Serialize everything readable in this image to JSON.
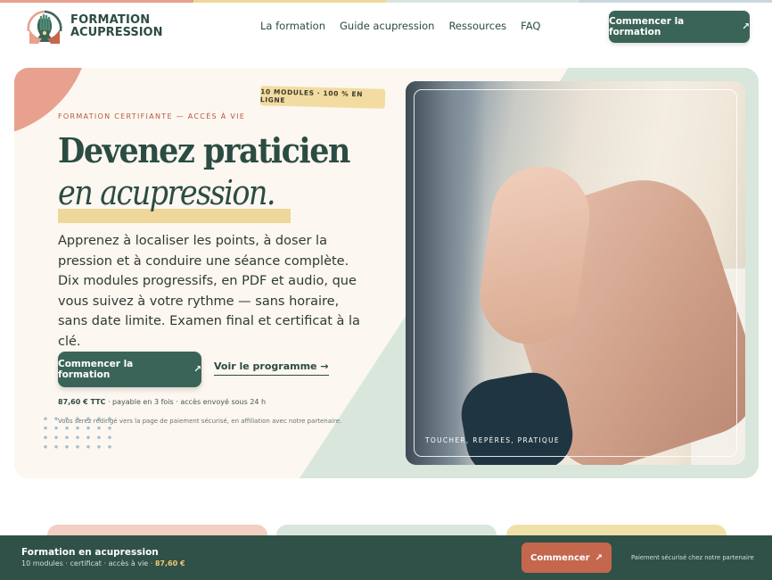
{
  "colors": {
    "strip": [
      "#e8a18e",
      "#efd79b",
      "#d8e6dc",
      "#c9d7df"
    ],
    "primary": "#3b6458",
    "coral": "#c4674d",
    "cards": [
      "#f1cfc2",
      "#d8e6dc",
      "#efe0a8"
    ]
  },
  "brand": {
    "line1": "FORMATION",
    "line2": "ACUPRESSION",
    "logo_icon": "hands-leaves-logo"
  },
  "nav": {
    "items": [
      "La formation",
      "Guide acupression",
      "Ressources",
      "FAQ"
    ]
  },
  "header_cta": {
    "label": "Commencer la formation",
    "icon": "arrow-up-right-icon"
  },
  "hero": {
    "eyebrow": "FORMATION CERTIFIANTE — ACCÈS À VIE",
    "badge": "10 MODULES · 100 % EN LIGNE",
    "title_line1": "Devenez praticien",
    "title_line2": "en acupression.",
    "lead": "Apprenez à localiser les points, à doser la pression et à conduire une séance complète. Dix modules progressifs, en PDF et audio, que vous suivez à votre rythme — sans horaire, sans date limite. Examen final et certificat à la clé.",
    "cta_primary": "Commencer la formation",
    "cta_secondary": "Voir le programme →",
    "price": "87,60 € TTC",
    "price_details": " · payable en 3 fois · accès envoyé sous 24 h",
    "redirect_note": "Vous serez redirigé vers la page de paiement sécurisé, en affiliation avec notre partenaire.",
    "photo_caption": "TOUCHER, REPÈRES, PRATIQUE"
  },
  "sticky_bar": {
    "title": "Formation en acupression",
    "subtitle": "10 modules · certificat · accès à vie · ",
    "price": "87,60 €",
    "button": "Commencer",
    "secure_note": "Paiement sécurisé chez notre partenaire"
  }
}
